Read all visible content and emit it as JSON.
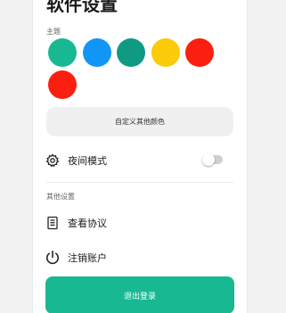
{
  "header": {
    "title": "软件设置"
  },
  "theme": {
    "section_label": "主题",
    "swatches": [
      {
        "name": "teal",
        "color": "#17b892"
      },
      {
        "name": "blue",
        "color": "#1296f5"
      },
      {
        "name": "dark-teal",
        "color": "#0f9a84"
      },
      {
        "name": "yellow",
        "color": "#fccb09"
      },
      {
        "name": "red",
        "color": "#fa1f10"
      },
      {
        "name": "red-2",
        "color": "#fa1f10"
      }
    ],
    "custom_color_label": "自定义其他颜色"
  },
  "night_mode": {
    "label": "夜间模式",
    "icon": "gear-icon",
    "enabled": false
  },
  "other_settings": {
    "section_label": "其他设置",
    "items": [
      {
        "label": "查看协议",
        "icon": "document-icon"
      },
      {
        "label": "注销账户",
        "icon": "power-icon"
      }
    ]
  },
  "logout": {
    "label": "退出登录"
  },
  "colors": {
    "accent": "#17b892",
    "toggle_off": "#cfcfcf"
  }
}
